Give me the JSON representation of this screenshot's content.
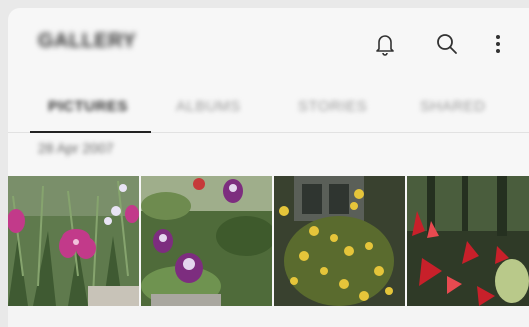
{
  "app": {
    "title": "GALLERY"
  },
  "header": {
    "icons": [
      "bell-icon",
      "search-icon",
      "more-vertical-icon"
    ]
  },
  "tabs": [
    {
      "label": "PICTURES",
      "active": true
    },
    {
      "label": "ALBUMS",
      "active": false
    },
    {
      "label": "STORIES",
      "active": false
    },
    {
      "label": "SHARED",
      "active": false
    }
  ],
  "section": {
    "date": "28 Apr 2007"
  },
  "photos": [
    {
      "subject": "pink-carnation-flowers"
    },
    {
      "subject": "purple-columbine-flowers"
    },
    {
      "subject": "yellow-flowering-shrub"
    },
    {
      "subject": "red-leaf-plant"
    }
  ],
  "colors": {
    "background": "#f7f7f7",
    "text": "#333333",
    "tab_indicator": "#222222"
  }
}
